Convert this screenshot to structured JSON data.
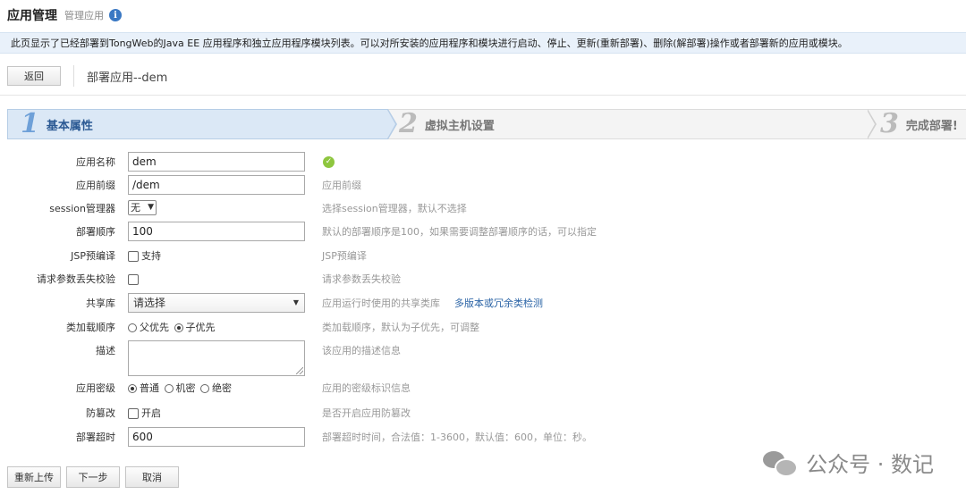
{
  "header": {
    "title": "应用管理",
    "subtitle": "管理应用",
    "info_icon": "info-icon"
  },
  "description": "此页显示了已经部署到TongWeb的Java EE 应用程序和独立应用程序模块列表。可以对所安装的应用程序和模块进行启动、停止、更新(重新部署)、删除(解部署)操作或者部署新的应用或模块。",
  "toolbar": {
    "back_label": "返回",
    "page_title": "部署应用--dem"
  },
  "steps": [
    {
      "num": "1",
      "label": "基本属性",
      "active": true
    },
    {
      "num": "2",
      "label": "虚拟主机设置",
      "active": false
    },
    {
      "num": "3",
      "label": "完成部署!",
      "active": false
    }
  ],
  "form": {
    "app_name": {
      "label": "应用名称",
      "value": "dem",
      "status_icon": "check-icon"
    },
    "app_prefix": {
      "label": "应用前缀",
      "value": "/dem",
      "hint": "应用前缀"
    },
    "session_manager": {
      "label": "session管理器",
      "value": "无",
      "hint": "选择session管理器，默认不选择"
    },
    "deploy_order": {
      "label": "部署顺序",
      "value": "100",
      "hint": "默认的部署顺序是100，如果需要调整部署顺序的话，可以指定"
    },
    "jsp_precompile": {
      "label": "JSP预编译",
      "option": "支持",
      "checked": false,
      "hint": "JSP预编译"
    },
    "param_loss_check": {
      "label": "请求参数丢失校验",
      "checked": false,
      "hint": "请求参数丢失校验"
    },
    "shared_lib": {
      "label": "共享库",
      "value": "请选择",
      "hint": "应用运行时使用的共享类库",
      "link": "多版本或冗余类检测"
    },
    "class_load_order": {
      "label": "类加载顺序",
      "options": [
        "父优先",
        "子优先"
      ],
      "selected": "子优先",
      "hint": "类加载顺序，默认为子优先，可调整"
    },
    "description": {
      "label": "描述",
      "value": "",
      "hint": "该应用的描述信息"
    },
    "security_level": {
      "label": "应用密级",
      "options": [
        "普通",
        "机密",
        "绝密"
      ],
      "selected": "普通",
      "hint": "应用的密级标识信息"
    },
    "tamper_proof": {
      "label": "防篡改",
      "option": "开启",
      "checked": false,
      "hint": "是否开启应用防篡改"
    },
    "deploy_timeout": {
      "label": "部署超时",
      "value": "600",
      "hint": "部署超时时间，合法值：1-3600，默认值：600，单位：秒。"
    }
  },
  "buttons": {
    "reupload": "重新上传",
    "next": "下一步",
    "cancel": "取消"
  },
  "watermark": {
    "text": "公众号 · 数记",
    "icon": "wechat-icon"
  }
}
